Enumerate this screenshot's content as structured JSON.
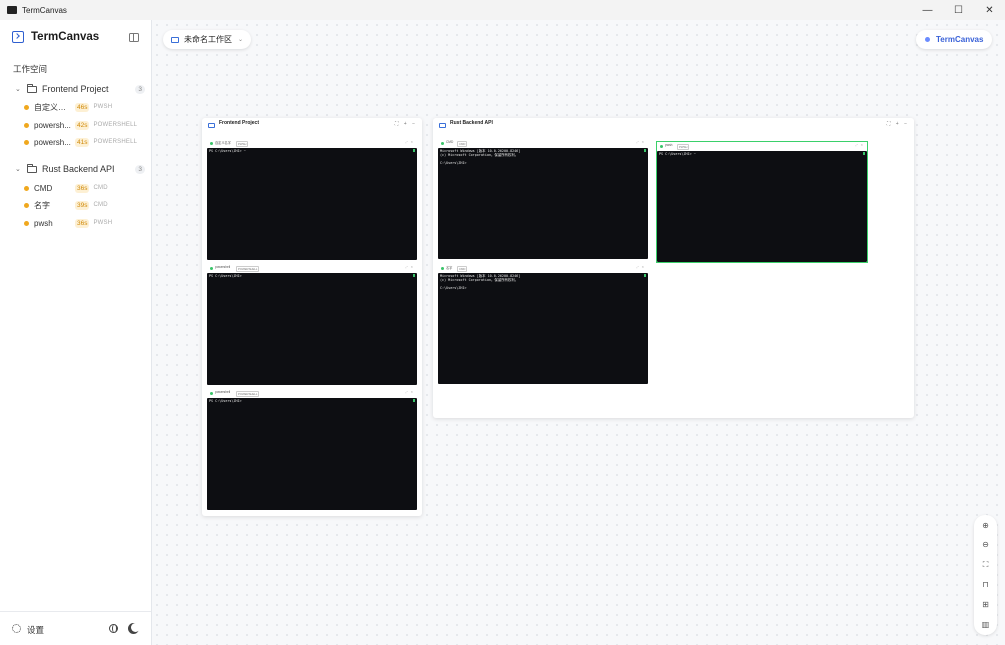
{
  "window": {
    "title": "TermCanvas",
    "controls": [
      "—",
      "☐",
      "✕"
    ]
  },
  "sidebar": {
    "brand": "TermCanvas",
    "section_label": "工作空间",
    "groups": [
      {
        "name": "Frontend Project",
        "count": "3",
        "items": [
          {
            "name": "自定义名字",
            "time": "46s",
            "shell": "PWSH"
          },
          {
            "name": "powersh...",
            "time": "42s",
            "shell": "POWERSHELL"
          },
          {
            "name": "powersh...",
            "time": "41s",
            "shell": "POWERSHELL"
          }
        ]
      },
      {
        "name": "Rust Backend API",
        "count": "3",
        "items": [
          {
            "name": "CMD",
            "time": "36s",
            "shell": "CMD"
          },
          {
            "name": "名字",
            "time": "39s",
            "shell": "CMD"
          },
          {
            "name": "pwsh",
            "time": "36s",
            "shell": "PWSH"
          }
        ]
      }
    ],
    "footer": {
      "settings_label": "设置"
    }
  },
  "canvas": {
    "workspace_name": "未命名工作区",
    "brand_badge": "TermCanvas",
    "panels": [
      {
        "title": "Frontend Project",
        "terminals": [
          {
            "label": "自定义名字",
            "badge": "PWSH",
            "lines": [
              "PS C:\\Users\\ZHI> ~"
            ]
          },
          {
            "label": "powershell",
            "badge": "POWERSHELL",
            "lines": [
              "PS C:\\Users\\ZHI>"
            ]
          },
          {
            "label": "powershell",
            "badge": "POWERSHELL",
            "lines": [
              "PS C:\\Users\\ZHI>"
            ]
          }
        ]
      },
      {
        "title": "Rust Backend API",
        "terminals": [
          {
            "label": "CMD",
            "badge": "CMD",
            "lines": [
              "Microsoft Windows [版本 10.0.26200.8246]",
              "(c) Microsoft Corporation。保留所有权利。",
              "",
              "C:\\Users\\ZHI>"
            ]
          },
          {
            "label": "pwsh",
            "badge": "PWSH",
            "lines": [
              "PS C:\\Users\\ZHI> ~"
            ]
          },
          {
            "label": "名字",
            "badge": "CMD",
            "lines": [
              "Microsoft Windows [版本 10.0.26200.8246]",
              "(c) Microsoft Corporation。保留所有权利。",
              "",
              "C:\\Users\\ZHI>"
            ]
          }
        ]
      }
    ]
  },
  "icons": {
    "zoom_in": "zoom-in-icon",
    "zoom_out": "zoom-out-icon",
    "fit": "fit-view-icon",
    "lock": "lock-icon",
    "grid": "grid-icon",
    "map": "minimap-icon"
  },
  "colors": {
    "accent": "#3a62d8",
    "running": "#f0a81e",
    "terminal_bg": "#0d0e12",
    "selection": "#3ad06a"
  }
}
